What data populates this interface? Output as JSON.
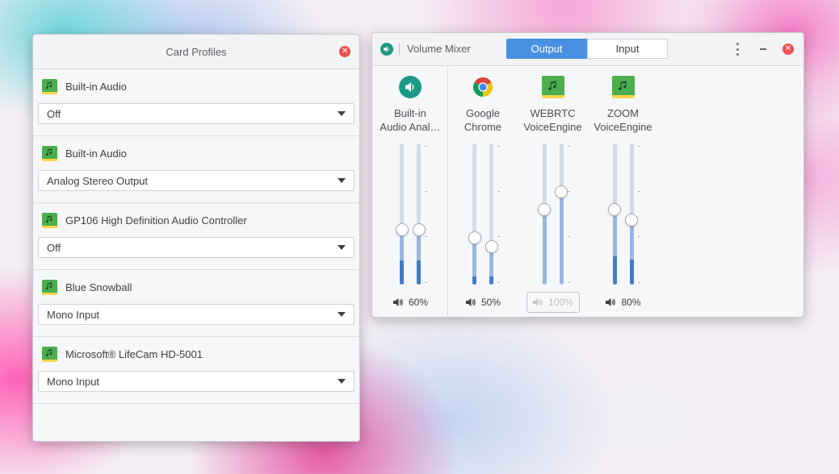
{
  "card_profiles": {
    "title": "Card Profiles",
    "cards": [
      {
        "name": "Built-in Audio",
        "profile": "Off"
      },
      {
        "name": "Built-in Audio",
        "profile": "Analog Stereo Output"
      },
      {
        "name": "GP106 High Definition Audio Controller",
        "profile": "Off"
      },
      {
        "name": "Blue Snowball",
        "profile": "Mono Input"
      },
      {
        "name": "Microsoft® LifeCam HD-5001",
        "profile": "Mono Input"
      }
    ]
  },
  "volume_mixer": {
    "title": "Volume Mixer",
    "tabs": [
      {
        "label": "Output",
        "active": true
      },
      {
        "label": "Input",
        "active": false
      }
    ],
    "streams": [
      {
        "name_line1": "Built-in",
        "name_line2": "Audio Anal…",
        "icon": "speaker-app-icon",
        "volume_label": "60%",
        "left_level": 0.39,
        "right_level": 0.39,
        "left_peak": 0.17,
        "right_peak": 0.17,
        "muted": false
      },
      {
        "name_line1": "Google",
        "name_line2": "Chrome",
        "icon": "chrome-icon",
        "volume_label": "50%",
        "left_level": 0.33,
        "right_level": 0.27,
        "left_peak": 0.06,
        "right_peak": 0.06,
        "muted": false
      },
      {
        "name_line1": "WEBRTC",
        "name_line2": "VoiceEngine",
        "icon": "sound-card-icon",
        "volume_label": "100%",
        "left_level": 0.53,
        "right_level": 0.66,
        "left_peak": 0.0,
        "right_peak": 0.0,
        "muted": true
      },
      {
        "name_line1": "ZOOM",
        "name_line2": "VoiceEngine",
        "icon": "sound-card-icon",
        "volume_label": "80%",
        "left_level": 0.53,
        "right_level": 0.46,
        "left_peak": 0.2,
        "right_peak": 0.18,
        "muted": false
      }
    ]
  },
  "colors": {
    "accent": "#4a90e2",
    "close": "#ed5050",
    "card_icon": "#4cae4f",
    "app_icon": "#1a9a87"
  }
}
